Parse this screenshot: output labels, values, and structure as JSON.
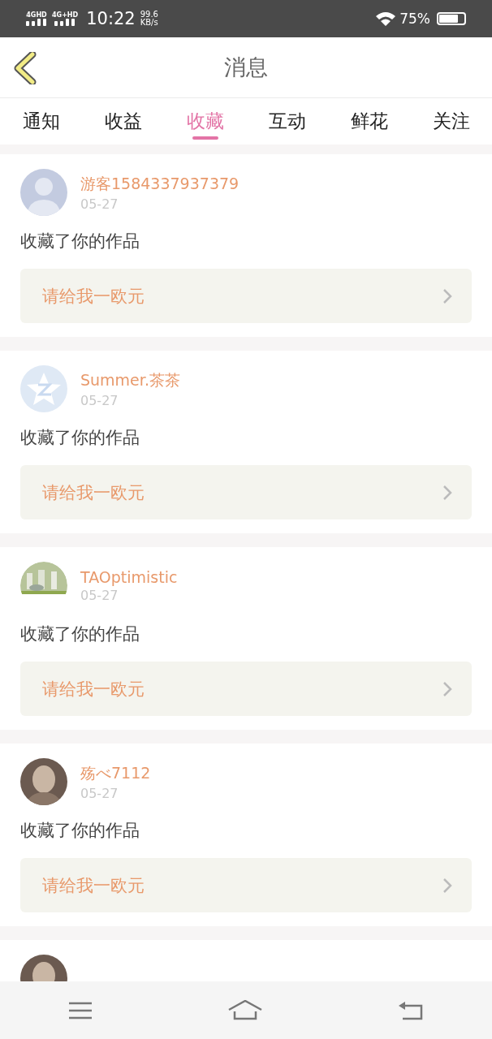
{
  "status_bar": {
    "sims": [
      "4GHD",
      "4G+HD"
    ],
    "time": "10:22",
    "speed": "99.6",
    "speed_unit": "KB/s",
    "battery": "75%"
  },
  "header": {
    "title": "消息"
  },
  "tabs": [
    {
      "label": "通知",
      "selected": false
    },
    {
      "label": "收益",
      "selected": false
    },
    {
      "label": "收藏",
      "selected": true
    },
    {
      "label": "互动",
      "selected": false
    },
    {
      "label": "鲜花",
      "selected": false
    },
    {
      "label": "关注",
      "selected": false
    }
  ],
  "messages": [
    {
      "kind": "silhouette",
      "name": "游客1584337937379",
      "date": "05-27",
      "text": "收藏了你的作品",
      "work": "请给我一欧元"
    },
    {
      "kind": "star",
      "name": "Summer.茶茶",
      "date": "05-27",
      "text": "收藏了你的作品",
      "work": "请给我一欧元"
    },
    {
      "kind": "picture",
      "name": "TAOptimistic",
      "date": "05-27",
      "text": "收藏了你的作品",
      "work": "请给我一欧元"
    },
    {
      "kind": "figure",
      "name": "殇べ7112",
      "date": "05-27",
      "text": "收藏了你的作品",
      "work": "请给我一欧元"
    },
    {
      "kind": "figure"
    }
  ]
}
